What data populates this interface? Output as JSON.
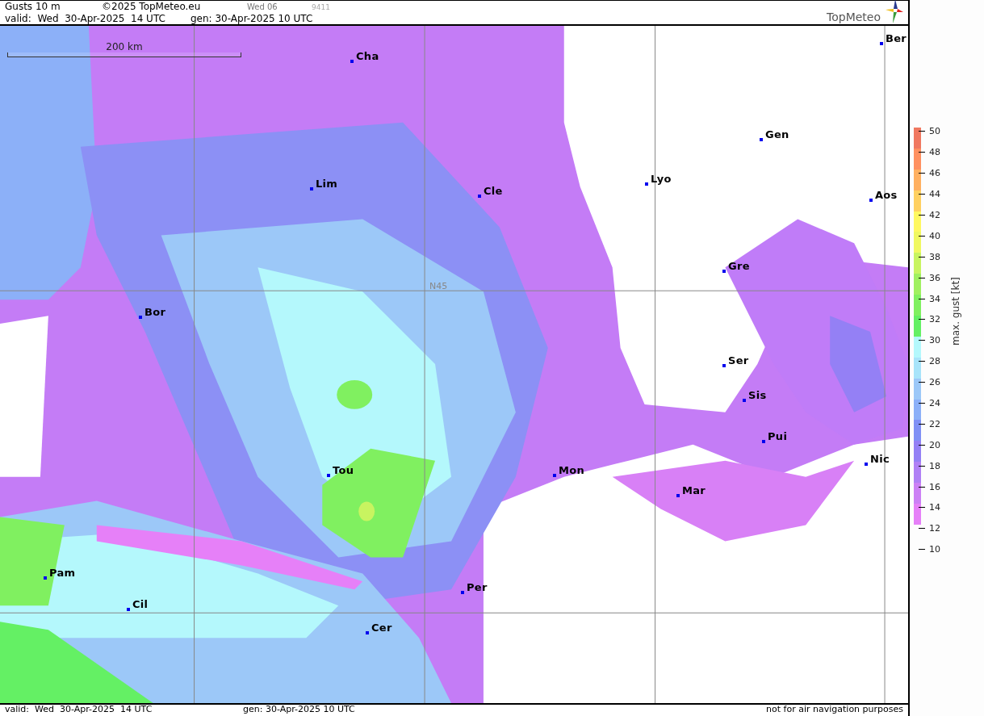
{
  "header": {
    "title": "Gusts 10 m",
    "copyright": "©2025 TopMeteo.eu",
    "run_day": "Wed 06",
    "code": "9411",
    "valid": "valid:  Wed  30-Apr-2025  14 UTC",
    "generated": "gen: 30-Apr-2025 10 UTC",
    "logo": "TopMeteo"
  },
  "map": {
    "scale": "200 km",
    "latitude_label": "N45",
    "cities": [
      {
        "name": "Cha"
      },
      {
        "name": "Lim"
      },
      {
        "name": "Cle"
      },
      {
        "name": "Lyo"
      },
      {
        "name": "Gen"
      },
      {
        "name": "Ber"
      },
      {
        "name": "Aos"
      },
      {
        "name": "Gre"
      },
      {
        "name": "Bor"
      },
      {
        "name": "Ser"
      },
      {
        "name": "Sis"
      },
      {
        "name": "Pui"
      },
      {
        "name": "Nic"
      },
      {
        "name": "Tou"
      },
      {
        "name": "Mon"
      },
      {
        "name": "Mar"
      },
      {
        "name": "Pam"
      },
      {
        "name": "Cil"
      },
      {
        "name": "Per"
      },
      {
        "name": "Cer"
      }
    ]
  },
  "legend": {
    "title": "max. gust [kt]",
    "ticks": [
      "50",
      "48",
      "46",
      "44",
      "42",
      "40",
      "38",
      "36",
      "34",
      "32",
      "30",
      "28",
      "26",
      "24",
      "22",
      "20",
      "18",
      "16",
      "14",
      "12",
      "10"
    ],
    "bands": [
      {
        "color": "#f07860"
      },
      {
        "color": "#ff9060"
      },
      {
        "color": "#ffb060"
      },
      {
        "color": "#ffd060"
      },
      {
        "color": "#fff860"
      },
      {
        "color": "#f0f860"
      },
      {
        "color": "#c8f460"
      },
      {
        "color": "#a0f060"
      },
      {
        "color": "#80f060"
      },
      {
        "color": "#64f064"
      },
      {
        "color": "#b4f8fc"
      },
      {
        "color": "#a8e4fa"
      },
      {
        "color": "#9cc8f8"
      },
      {
        "color": "#8cb0f8"
      },
      {
        "color": "#8090f5"
      },
      {
        "color": "#9480f5"
      },
      {
        "color": "#b080f5"
      },
      {
        "color": "#cc80f5"
      },
      {
        "color": "#e680f8"
      }
    ]
  },
  "footer": {
    "valid": "valid:  Wed  30-Apr-2025  14 UTC",
    "generated": "gen: 30-Apr-2025 10 UTC",
    "notice": "not for air navigation purposes"
  }
}
